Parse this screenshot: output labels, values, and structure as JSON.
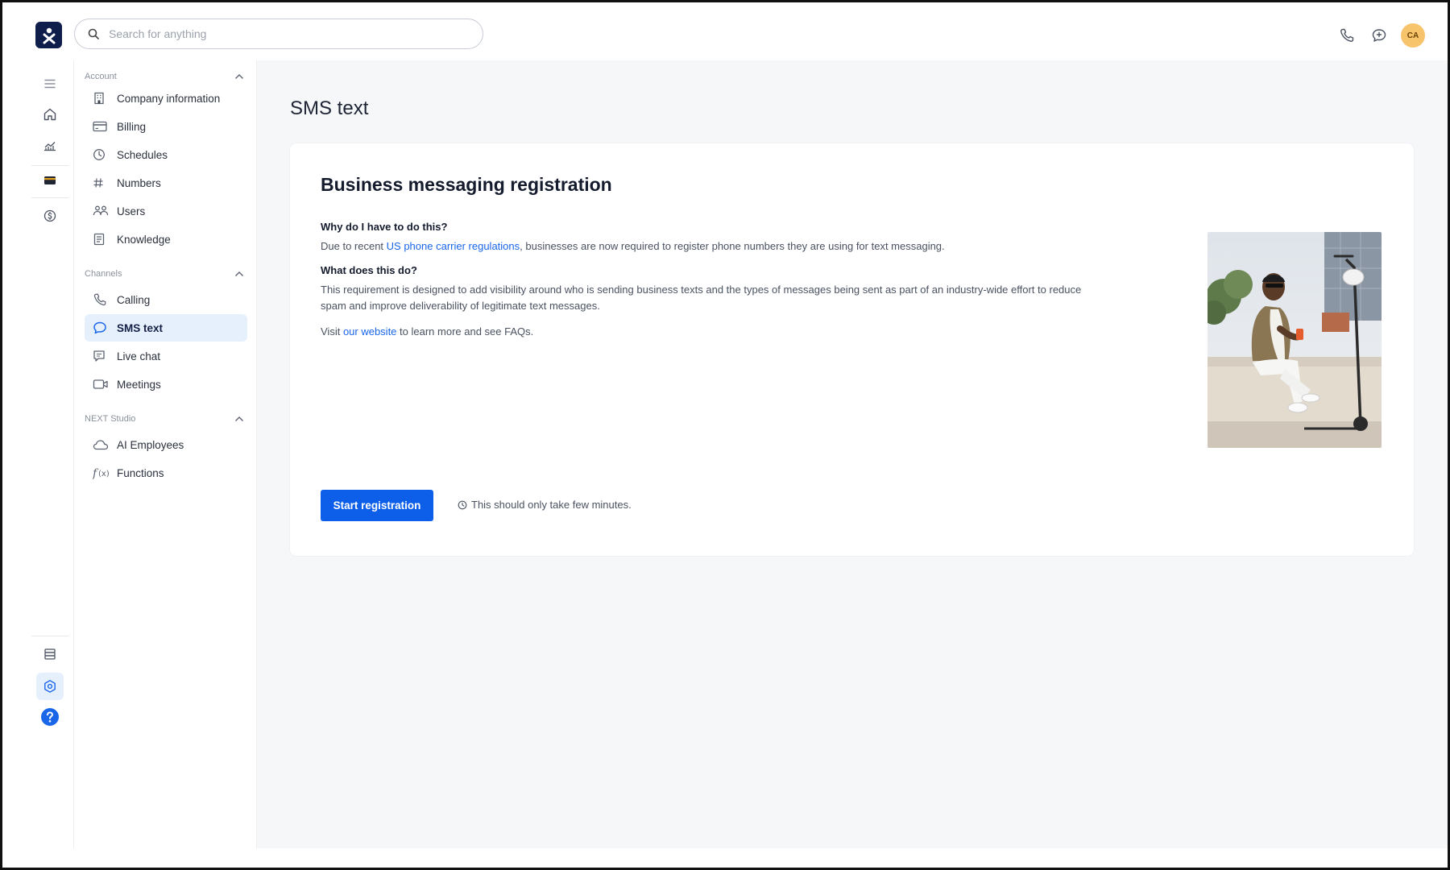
{
  "header": {
    "search_placeholder": "Search for anything",
    "avatar_initials": "CA"
  },
  "sidebar": {
    "sections": [
      {
        "title": "Account",
        "items": [
          {
            "label": "Company information",
            "icon": "building-icon"
          },
          {
            "label": "Billing",
            "icon": "credit-card-icon"
          },
          {
            "label": "Schedules",
            "icon": "clock-icon"
          },
          {
            "label": "Numbers",
            "icon": "hash-icon"
          },
          {
            "label": "Users",
            "icon": "users-icon"
          },
          {
            "label": "Knowledge",
            "icon": "book-icon"
          }
        ]
      },
      {
        "title": "Channels",
        "items": [
          {
            "label": "Calling",
            "icon": "phone-icon"
          },
          {
            "label": "SMS text",
            "icon": "message-icon",
            "active": true
          },
          {
            "label": "Live chat",
            "icon": "chat-icon"
          },
          {
            "label": "Meetings",
            "icon": "video-icon"
          }
        ]
      },
      {
        "title": "NEXT Studio",
        "items": [
          {
            "label": "AI Employees",
            "icon": "cloud-icon"
          },
          {
            "label": "Functions",
            "icon": "function-icon"
          }
        ]
      }
    ]
  },
  "main": {
    "page_title": "SMS text",
    "card": {
      "title": "Business messaging registration",
      "q1": "Why do I have to do this?",
      "p1_before": "Due to recent ",
      "p1_link": "US phone carrier regulations",
      "p1_after": ", businesses are now required to register phone numbers they are using for text messaging.",
      "q2": "What does this do?",
      "p2": "This requirement is designed to add visibility around who is sending business texts and the types of messages being sent as part of an industry-wide effort to reduce spam and improve deliverability of legitimate text messages.",
      "p3_before": "Visit ",
      "p3_link": "our website",
      "p3_after": " to learn more and see FAQs.",
      "button": "Start registration",
      "hint": "This should only take few minutes."
    }
  },
  "colors": {
    "accent": "#0d5ee8",
    "brand": "#0f1e4a",
    "active_bg": "#e6f0fd",
    "avatar_bg": "#f7c36b"
  }
}
